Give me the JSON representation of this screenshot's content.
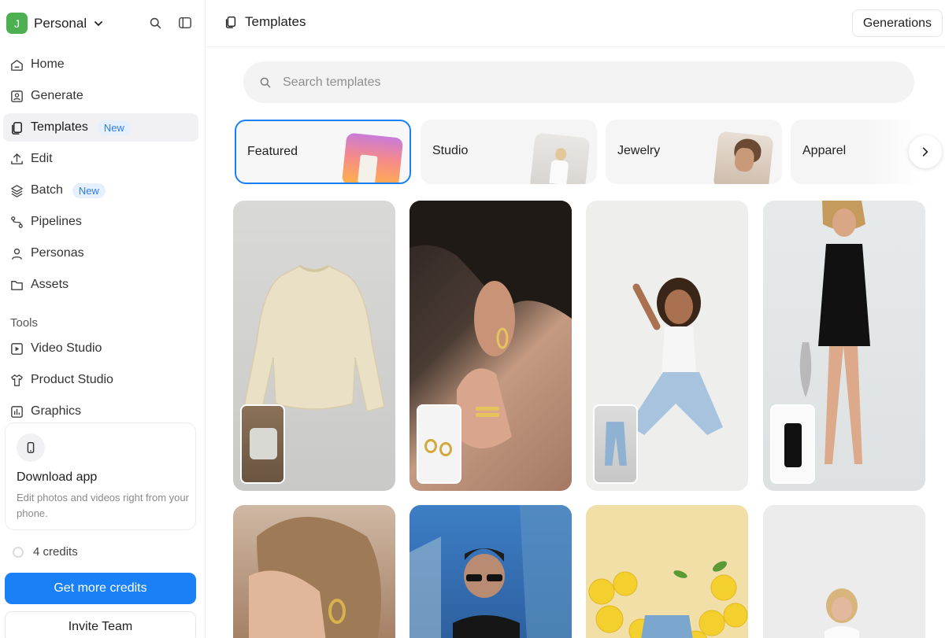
{
  "workspace": {
    "initial": "J",
    "name": "Personal"
  },
  "nav": [
    {
      "id": "home",
      "label": "Home"
    },
    {
      "id": "generate",
      "label": "Generate"
    },
    {
      "id": "templates",
      "label": "Templates",
      "badge": "New",
      "active": true
    },
    {
      "id": "edit",
      "label": "Edit"
    },
    {
      "id": "batch",
      "label": "Batch",
      "badge": "New"
    },
    {
      "id": "pipelines",
      "label": "Pipelines"
    },
    {
      "id": "personas",
      "label": "Personas"
    },
    {
      "id": "assets",
      "label": "Assets"
    }
  ],
  "tools": {
    "label": "Tools",
    "items": [
      {
        "id": "video-studio",
        "label": "Video Studio"
      },
      {
        "id": "product-studio",
        "label": "Product Studio"
      },
      {
        "id": "graphics",
        "label": "Graphics"
      }
    ]
  },
  "download": {
    "title": "Download app",
    "desc": "Edit photos and videos right from your phone."
  },
  "credits": {
    "text": "4 credits"
  },
  "buttons": {
    "get_credits": "Get more credits",
    "invite": "Invite Team",
    "generations": "Generations"
  },
  "header": {
    "title": "Templates"
  },
  "search": {
    "placeholder": "Search templates"
  },
  "categories": [
    {
      "label": "Featured",
      "selected": true
    },
    {
      "label": "Studio"
    },
    {
      "label": "Jewelry"
    },
    {
      "label": "Apparel"
    }
  ],
  "colors": {
    "accent": "#1a80f5",
    "badge_bg": "#e6f0fd",
    "badge_text": "#2f7de1",
    "avatar": "#4caf50"
  },
  "grid_tiles": [
    {
      "id": "sweatshirt",
      "inset": "sweatshirt"
    },
    {
      "id": "earrings",
      "inset": "hoop-earrings"
    },
    {
      "id": "jeans-model",
      "inset": "jeans"
    },
    {
      "id": "black-dress",
      "inset": "dress"
    },
    {
      "id": "woman-portrait"
    },
    {
      "id": "man-sunglasses"
    },
    {
      "id": "lemons-jacket"
    },
    {
      "id": "studio-woman"
    }
  ]
}
